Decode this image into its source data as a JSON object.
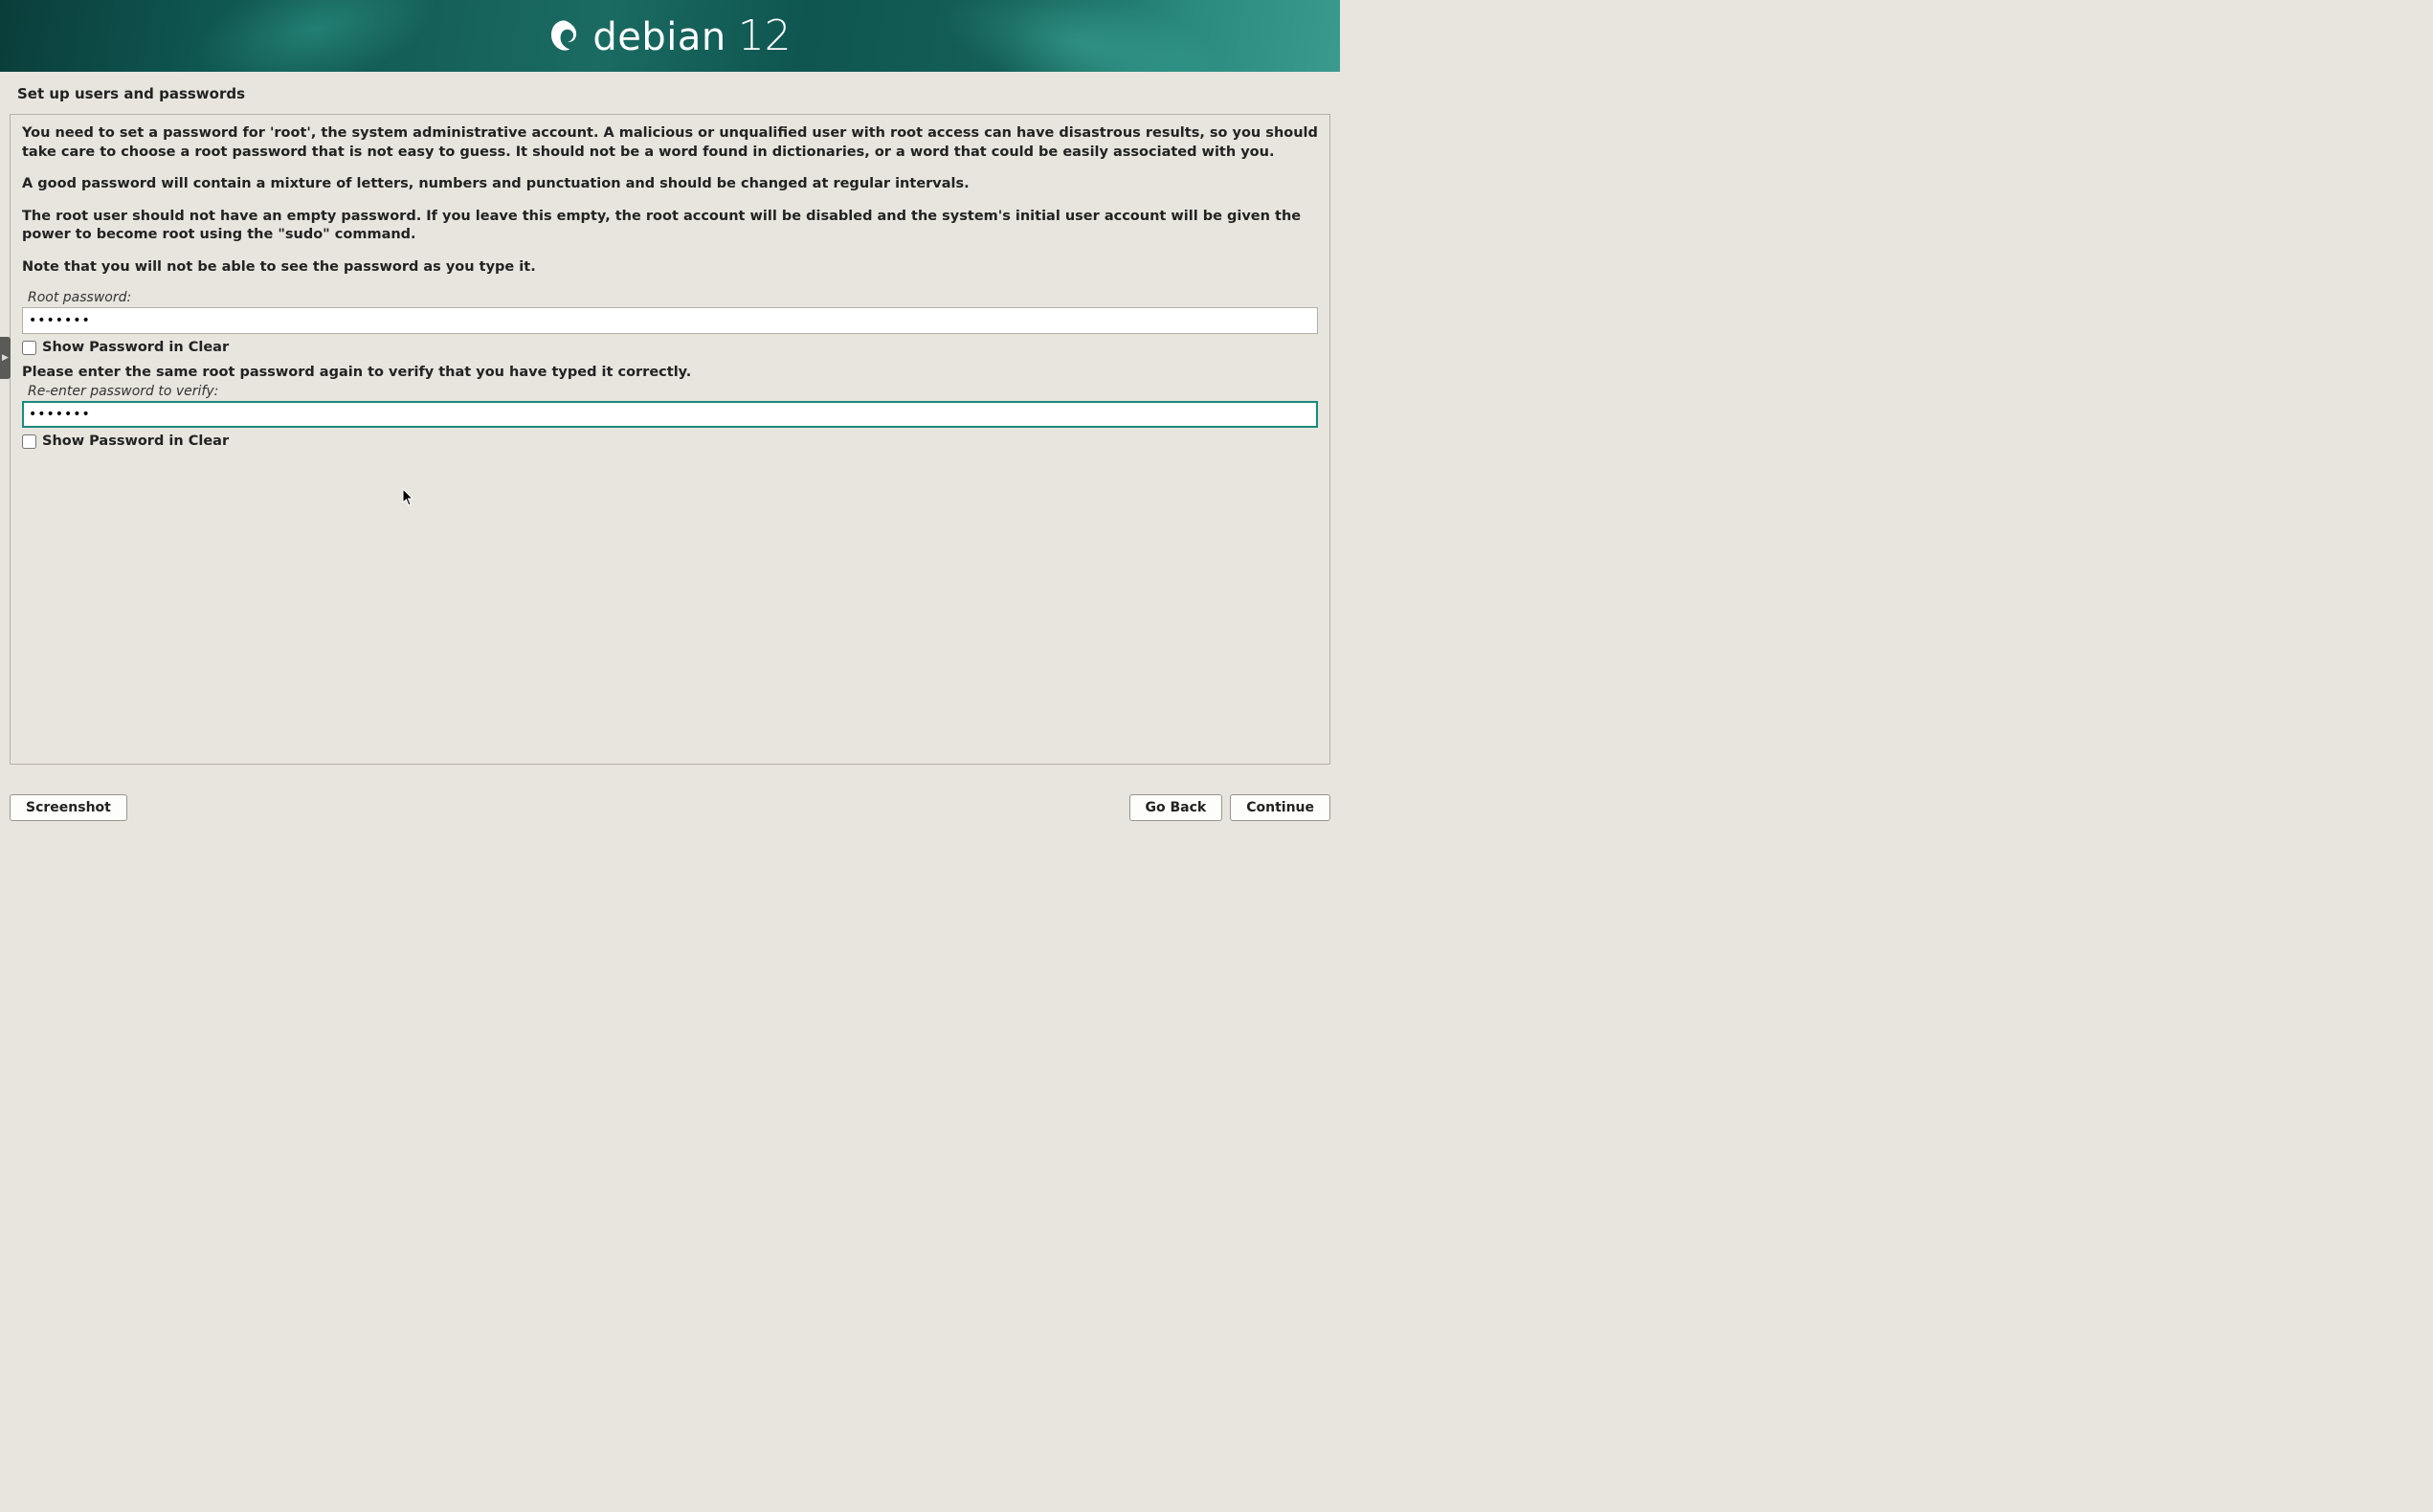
{
  "header": {
    "brand_name": "debian",
    "brand_version": "12"
  },
  "page": {
    "title": "Set up users and passwords",
    "desc_para1": "You need to set a password for 'root', the system administrative account. A malicious or unqualified user with root access can have disastrous results, so you should take care to choose a root password that is not easy to guess. It should not be a word found in dictionaries, or a word that could be easily associated with you.",
    "desc_para2": "A good password will contain a mixture of letters, numbers and punctuation and should be changed at regular intervals.",
    "desc_para3": "The root user should not have an empty password. If you leave this empty, the root account will be disabled and the system's initial user account will be given the power to become root using the \"sudo\" command.",
    "desc_para4": "Note that you will not be able to see the password as you type it.",
    "root_password_label": "Root password:",
    "root_password_value": "•••••••",
    "show_clear1_label": "Show Password in Clear",
    "verify_prompt": "Please enter the same root password again to verify that you have typed it correctly.",
    "reenter_label": "Re-enter password to verify:",
    "reenter_value": "•••••••",
    "show_clear2_label": "Show Password in Clear"
  },
  "footer": {
    "screenshot_label": "Screenshot",
    "goback_label": "Go Back",
    "continue_label": "Continue"
  }
}
